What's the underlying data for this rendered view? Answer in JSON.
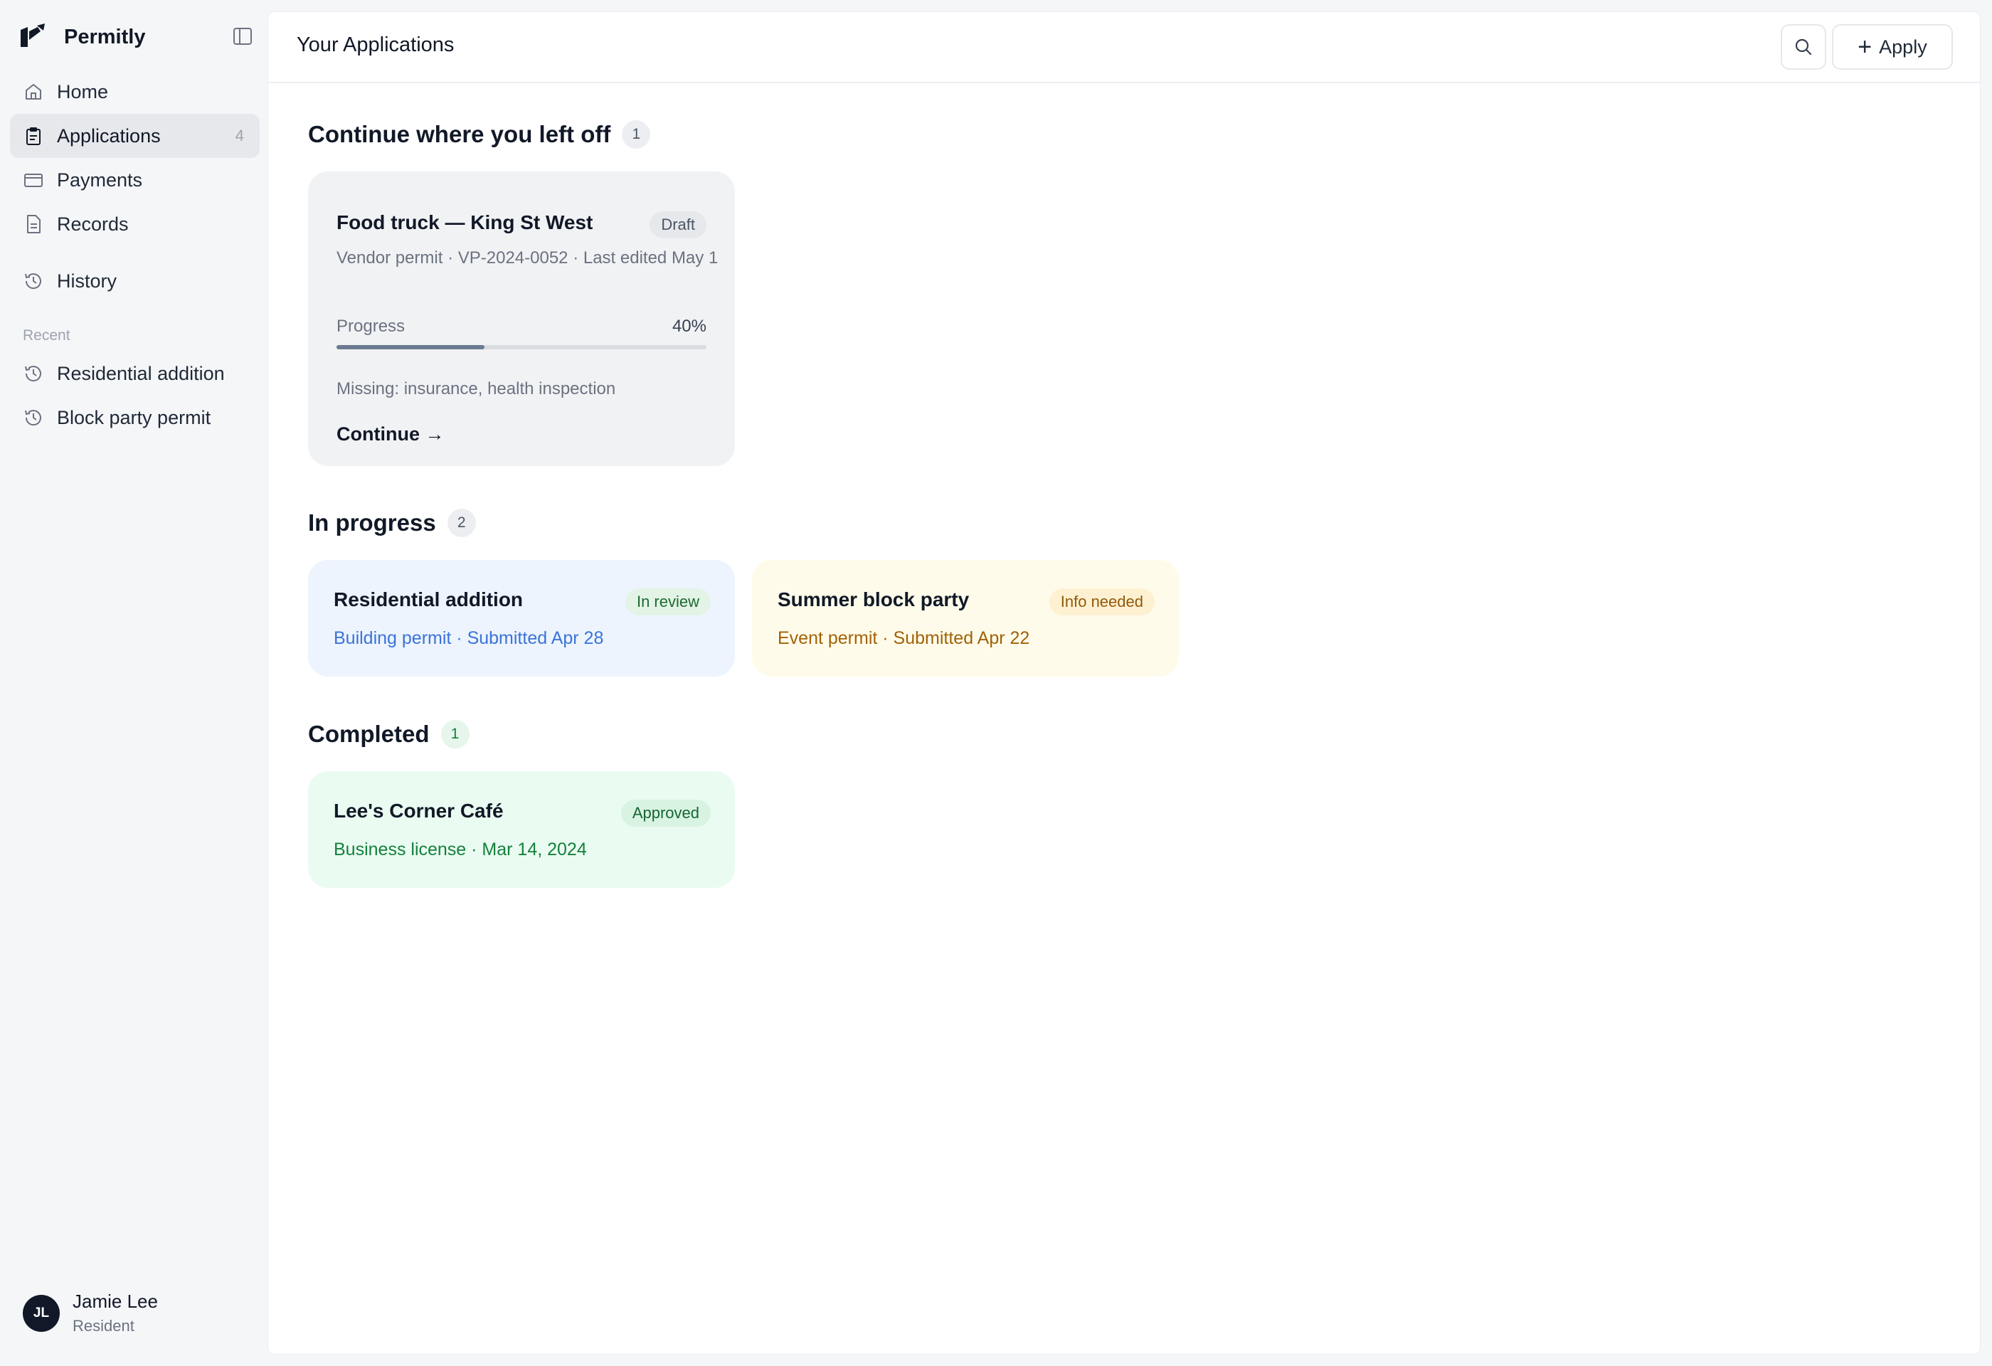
{
  "app": {
    "name": "Permitly"
  },
  "sidebar": {
    "items": [
      {
        "label": "Home",
        "icon": "home-icon"
      },
      {
        "label": "Applications",
        "icon": "clipboard-icon",
        "count": "4",
        "active": true
      },
      {
        "label": "Payments",
        "icon": "credit-card-icon"
      },
      {
        "label": "Records",
        "icon": "document-icon"
      },
      {
        "label": "History",
        "icon": "history-icon"
      }
    ],
    "recent_label": "Recent",
    "recent": [
      {
        "label": "Residential addition",
        "icon": "history-icon"
      },
      {
        "label": "Block party permit",
        "icon": "history-icon"
      }
    ],
    "user": {
      "initials": "JL",
      "name": "Jamie Lee",
      "role": "Resident"
    }
  },
  "header": {
    "title": "Your Applications",
    "apply_label": "Apply"
  },
  "sections": {
    "continue": {
      "title": "Continue where you left off",
      "count": "1",
      "card": {
        "title": "Food truck — King St West",
        "badge": "Draft",
        "meta": "Vendor permit · VP-2024-0052 · Last edited May 1",
        "progress_label": "Progress",
        "progress_value": "40%",
        "progress": 0.4,
        "missing": "Missing: insurance, health inspection",
        "action": "Continue →"
      }
    },
    "in_progress": {
      "title": "In progress",
      "count": "2",
      "cards": [
        {
          "title": "Residential addition",
          "badge": "In review",
          "sub": "Building permit · Submitted Apr 28"
        },
        {
          "title": "Summer block party",
          "badge": "Info needed",
          "sub": "Event permit · Submitted Apr 22"
        }
      ]
    },
    "completed": {
      "title": "Completed",
      "count": "1",
      "cards": [
        {
          "title": "Lee's Corner Café",
          "badge": "Approved",
          "sub": "Business license · Mar 14, 2024"
        }
      ]
    }
  },
  "colors": {
    "accent_blue": "#3b73d9",
    "status_review": "#1d6b32",
    "status_info": "#92580a",
    "status_approved": "#166534"
  }
}
